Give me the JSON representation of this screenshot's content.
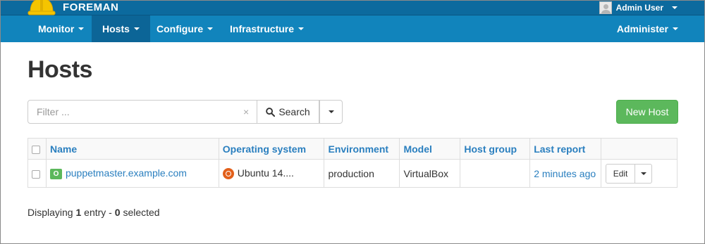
{
  "brand": {
    "name": "FOREMAN",
    "logo_icon": "hardhat-icon"
  },
  "user_menu": {
    "label": "Admin User",
    "avatar_icon": "avatar-icon"
  },
  "nav": {
    "items": [
      {
        "label": "Monitor",
        "active": false
      },
      {
        "label": "Hosts",
        "active": true
      },
      {
        "label": "Configure",
        "active": false
      },
      {
        "label": "Infrastructure",
        "active": false
      }
    ],
    "right_item": {
      "label": "Administer"
    }
  },
  "page": {
    "title": "Hosts"
  },
  "search": {
    "placeholder": "Filter ...",
    "value": "",
    "clear_label": "×",
    "button_label": "Search"
  },
  "actions": {
    "new_host_label": "New Host"
  },
  "table": {
    "columns": [
      "Name",
      "Operating system",
      "Environment",
      "Model",
      "Host group",
      "Last report"
    ],
    "rows": [
      {
        "name": "puppetmaster.example.com",
        "status_badge": "O",
        "os": "Ubuntu 14....",
        "environment": "production",
        "model": "VirtualBox",
        "host_group": "",
        "last_report": "2 minutes ago",
        "edit_label": "Edit"
      }
    ]
  },
  "footer": {
    "prefix": "Displaying",
    "count": "1",
    "middle": "entry -",
    "selected": "0",
    "suffix": "selected"
  },
  "colors": {
    "topbar": "#0c6a9e",
    "navbar": "#1184bc",
    "nav_active": "#0c6597",
    "link": "#2a7fbf",
    "success": "#5cb85c"
  }
}
